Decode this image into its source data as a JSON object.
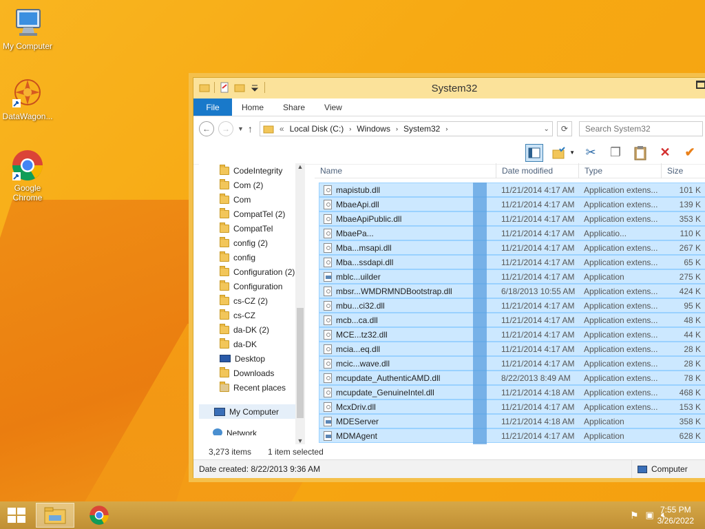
{
  "desktop": {
    "icons": [
      {
        "label": "My Computer",
        "icon": "monitor-icon"
      },
      {
        "label": "DataWagon...",
        "icon": "datawagon-icon"
      },
      {
        "label": "Google Chrome",
        "icon": "chrome-icon"
      }
    ]
  },
  "window": {
    "title": "System32",
    "ribbon_tabs": [
      "File",
      "Home",
      "Share",
      "View"
    ],
    "address_path": [
      "Local Disk (C:)",
      "Windows",
      "System32"
    ],
    "address_prefix": "«",
    "search_placeholder": "Search System32",
    "nav_pane": {
      "items": [
        "CodeIntegrity",
        "Com (2)",
        "Com",
        "CompatTel (2)",
        "CompatTel",
        "config (2)",
        "config",
        "Configuration (2)",
        "Configuration",
        "cs-CZ (2)",
        "cs-CZ",
        "da-DK (2)",
        "da-DK"
      ],
      "special": [
        {
          "label": "Desktop",
          "icon": "desktop-icon"
        },
        {
          "label": "Downloads",
          "icon": "downloads-icon"
        },
        {
          "label": "Recent places",
          "icon": "recent-places-icon"
        }
      ],
      "computer": "My Computer",
      "network_partial": "Network"
    },
    "columns": {
      "name": "Name",
      "date": "Date modified",
      "type": "Type",
      "size": "Size"
    },
    "files": [
      {
        "name": "mapistub.dll",
        "date": "11/21/2014 4:17 AM",
        "type": "Application extens...",
        "size": "101 K"
      },
      {
        "name": "MbaeApi.dll",
        "date": "11/21/2014 4:17 AM",
        "type": "Application extens...",
        "size": "139 K"
      },
      {
        "name": "MbaeApiPublic.dll",
        "date": "11/21/2014 4:17 AM",
        "type": "Application extens...",
        "size": "353 K"
      },
      {
        "name": "MbaePa...",
        "date": "11/21/2014 4:17 AM",
        "type": "Applicatio...",
        "size": "110 K"
      },
      {
        "name": "Mba...msapi.dll",
        "date": "11/21/2014 4:17 AM",
        "type": "Application extens...",
        "size": "267 K"
      },
      {
        "name": "Mba...ssdapi.dll",
        "date": "11/21/2014 4:17 AM",
        "type": "Application extens...",
        "size": "65 K"
      },
      {
        "name": "mblc...uilder",
        "date": "11/21/2014 4:17 AM",
        "type": "Application",
        "size": "275 K"
      },
      {
        "name": "mbsr...WMDRMNDBootstrap.dll",
        "date": "6/18/2013 10:55 AM",
        "type": "Application extens...",
        "size": "424 K"
      },
      {
        "name": "mbu...ci32.dll",
        "date": "11/21/2014 4:17 AM",
        "type": "Application extens...",
        "size": "95 K"
      },
      {
        "name": "mcb...ca.dll",
        "date": "11/21/2014 4:17 AM",
        "type": "Application extens...",
        "size": "48 K"
      },
      {
        "name": "MCE...tz32.dll",
        "date": "11/21/2014 4:17 AM",
        "type": "Application extens...",
        "size": "44 K"
      },
      {
        "name": "mcia...eq.dll",
        "date": "11/21/2014 4:17 AM",
        "type": "Application extens...",
        "size": "28 K"
      },
      {
        "name": "mcic...wave.dll",
        "date": "11/21/2014 4:17 AM",
        "type": "Application extens...",
        "size": "28 K"
      },
      {
        "name": "mcupdate_AuthenticAMD.dll",
        "date": "8/22/2013 8:49 AM",
        "type": "Application extens...",
        "size": "78 K"
      },
      {
        "name": "mcupdate_GenuineIntel.dll",
        "date": "11/21/2014 4:18 AM",
        "type": "Application extens...",
        "size": "468 K"
      },
      {
        "name": "McxDriv.dll",
        "date": "11/21/2014 4:17 AM",
        "type": "Application extens...",
        "size": "153 K"
      },
      {
        "name": "MDEServer",
        "date": "11/21/2014 4:18 AM",
        "type": "Application",
        "size": "358 K"
      },
      {
        "name": "MDMAgent",
        "date": "11/21/2014 4:17 AM",
        "type": "Application",
        "size": "628 K"
      }
    ],
    "status": {
      "count": "3,273 items",
      "selected": "1 item selected"
    },
    "details_bar": {
      "created": "Date created: 8/22/2013 9:36 AM",
      "location": "Computer"
    }
  },
  "taskbar": {
    "time": "7:55 PM",
    "date": "3/26/2022"
  },
  "colors": {
    "accent": "#1979ca",
    "selection": "#cce8ff",
    "desktop": "#f7a913"
  }
}
